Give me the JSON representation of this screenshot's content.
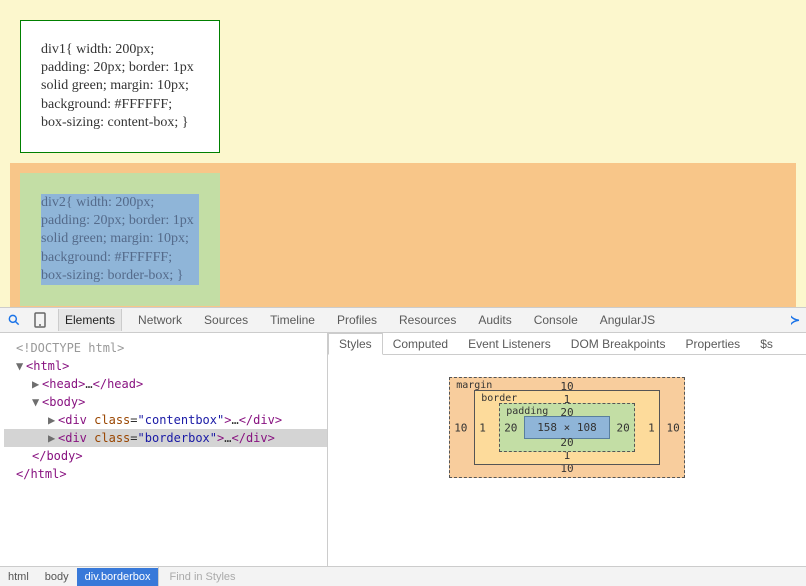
{
  "page": {
    "div1_text": "div1{ width: 200px; padding: 20px; border: 1px solid green; margin: 10px; background: #FFFFFF; box-sizing: content-box; }",
    "div2_text": "div2{ width: 200px; padding: 20px; border: 1px solid green; margin: 10px; background: #FFFFFF; box-sizing: border-box; }"
  },
  "toolbar": {
    "tabs": [
      "Elements",
      "Network",
      "Sources",
      "Timeline",
      "Profiles",
      "Resources",
      "Audits",
      "Console",
      "AngularJS"
    ],
    "active": "Elements"
  },
  "dom": {
    "l0": "<!DOCTYPE html>",
    "html_open": "html",
    "head_open": "head",
    "head_ell": "…",
    "head_close": "head",
    "body_open": "body",
    "div": "div",
    "class_attr": "class",
    "contentbox": "contentbox",
    "borderbox": "borderbox",
    "ell": "…",
    "body_close": "body",
    "html_close": "html"
  },
  "styles_tabs": {
    "t0": "Styles",
    "t1": "Computed",
    "t2": "Event Listeners",
    "t3": "DOM Breakpoints",
    "t4": "Properties",
    "t5": "$s"
  },
  "box": {
    "margin": {
      "label": "margin",
      "top": "10",
      "right": "10",
      "bottom": "10",
      "left": "10"
    },
    "border": {
      "label": "border",
      "top": "1",
      "right": "1",
      "bottom": "1",
      "left": "1"
    },
    "padding": {
      "label": "padding",
      "top": "20",
      "right": "20",
      "bottom": "20",
      "left": "20"
    },
    "content": "158 × 108"
  },
  "breadcrumb": {
    "b0": "html",
    "b1": "body",
    "b2": "div.borderbox"
  },
  "find": "Find in Styles"
}
